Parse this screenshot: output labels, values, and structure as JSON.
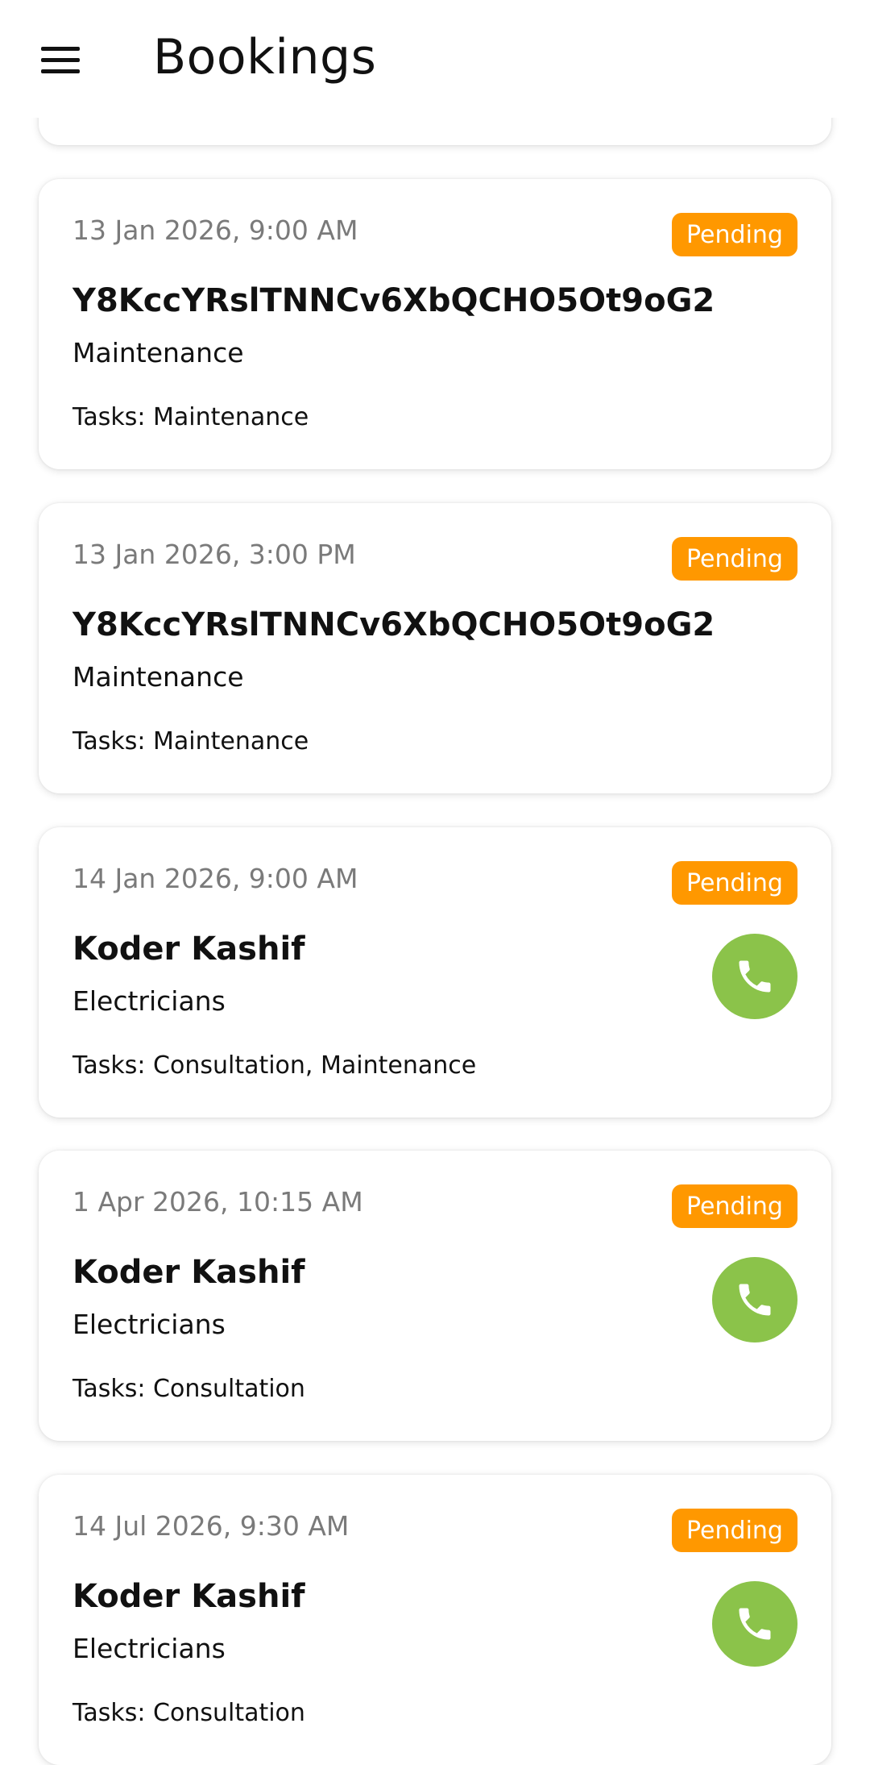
{
  "header": {
    "title": "Bookings",
    "menu_icon": "hamburger-menu-icon"
  },
  "bookings": [
    {
      "datetime": "13 Jan 2026, 9:00 AM",
      "status": "Pending",
      "name": "Y8KccYRslTNNCv6XbQCHO5Ot9oG2",
      "category": "Maintenance",
      "tasks": "Tasks: Maintenance",
      "has_call": false
    },
    {
      "datetime": "13 Jan 2026, 3:00 PM",
      "status": "Pending",
      "name": "Y8KccYRslTNNCv6XbQCHO5Ot9oG2",
      "category": "Maintenance",
      "tasks": "Tasks: Maintenance",
      "has_call": false
    },
    {
      "datetime": "14 Jan 2026, 9:00 AM",
      "status": "Pending",
      "name": "Koder Kashif",
      "category": "Electricians",
      "tasks": "Tasks: Consultation, Maintenance",
      "has_call": true
    },
    {
      "datetime": "1 Apr 2026, 10:15 AM",
      "status": "Pending",
      "name": "Koder Kashif",
      "category": "Electricians",
      "tasks": "Tasks: Consultation",
      "has_call": true
    },
    {
      "datetime": "14 Jul 2026, 9:30 AM",
      "status": "Pending",
      "name": "Koder Kashif",
      "category": "Electricians",
      "tasks": "Tasks: Consultation",
      "has_call": true
    }
  ],
  "colors": {
    "pending_badge": "#ff9800",
    "call_button": "#8bc34a"
  }
}
